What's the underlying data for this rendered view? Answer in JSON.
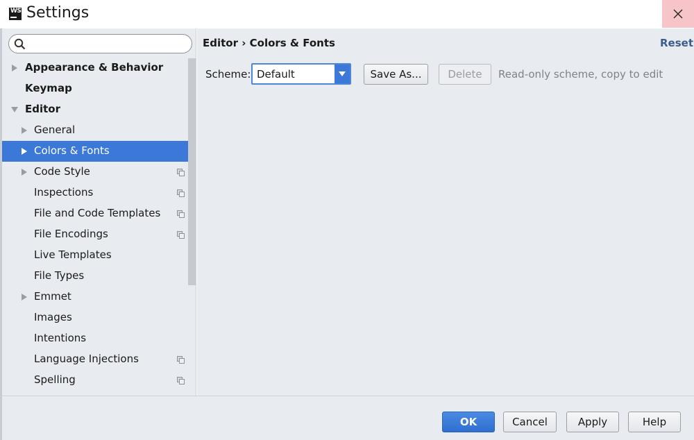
{
  "window": {
    "title": "Settings",
    "logo_text": "WS"
  },
  "search": {
    "placeholder": "",
    "value": ""
  },
  "sidebar": {
    "items": [
      {
        "label": "Appearance & Behavior",
        "bold": true,
        "arrow": "right",
        "level": 0
      },
      {
        "label": "Keymap",
        "bold": true,
        "arrow": "none",
        "level": 0
      },
      {
        "label": "Editor",
        "bold": true,
        "arrow": "down",
        "level": 0
      },
      {
        "label": "General",
        "bold": false,
        "arrow": "right",
        "level": 1
      },
      {
        "label": "Colors & Fonts",
        "bold": false,
        "arrow": "right",
        "level": 1,
        "selected": true
      },
      {
        "label": "Code Style",
        "bold": false,
        "arrow": "right",
        "level": 1,
        "project_icon": true
      },
      {
        "label": "Inspections",
        "bold": false,
        "arrow": "none",
        "level": 1,
        "project_icon": true
      },
      {
        "label": "File and Code Templates",
        "bold": false,
        "arrow": "none",
        "level": 1,
        "project_icon": true
      },
      {
        "label": "File Encodings",
        "bold": false,
        "arrow": "none",
        "level": 1,
        "project_icon": true
      },
      {
        "label": "Live Templates",
        "bold": false,
        "arrow": "none",
        "level": 1
      },
      {
        "label": "File Types",
        "bold": false,
        "arrow": "none",
        "level": 1
      },
      {
        "label": "Emmet",
        "bold": false,
        "arrow": "right",
        "level": 1
      },
      {
        "label": "Images",
        "bold": false,
        "arrow": "none",
        "level": 1
      },
      {
        "label": "Intentions",
        "bold": false,
        "arrow": "none",
        "level": 1
      },
      {
        "label": "Language Injections",
        "bold": false,
        "arrow": "none",
        "level": 1,
        "project_icon": true
      },
      {
        "label": "Spelling",
        "bold": false,
        "arrow": "none",
        "level": 1,
        "project_icon": true
      }
    ]
  },
  "content": {
    "breadcrumb": "Editor › Colors & Fonts",
    "reset_label": "Reset",
    "scheme_label": "Scheme:",
    "scheme_value": "Default",
    "save_as_label": "Save As...",
    "delete_label": "Delete",
    "hint": "Read-only scheme, copy to edit"
  },
  "footer": {
    "ok_label": "OK",
    "cancel_label": "Cancel",
    "apply_label": "Apply",
    "help_label": "Help"
  },
  "colors": {
    "selection": "#3b78d8",
    "panel_bg": "#e8ebf0",
    "close_hover": "#f6c4c9",
    "link": "#3d5d8c"
  }
}
